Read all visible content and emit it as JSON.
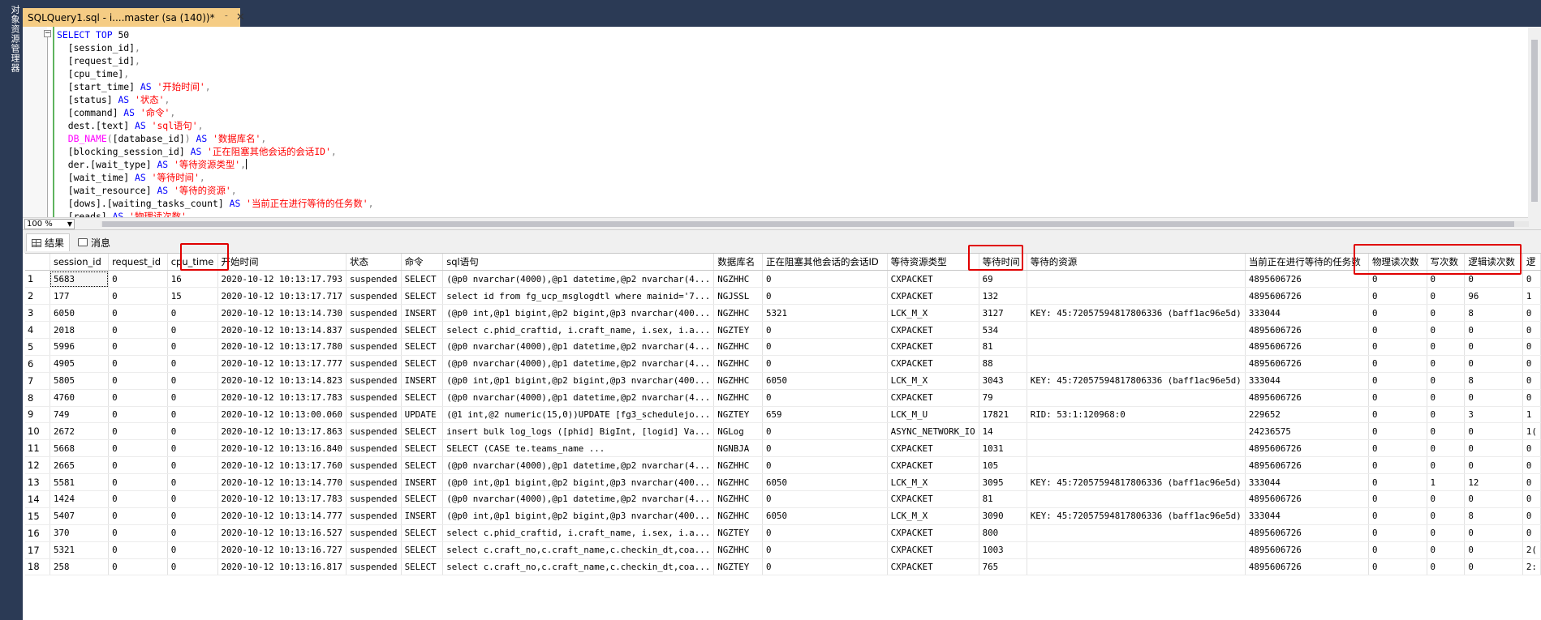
{
  "sidebar": {
    "label": "对象资源管理器"
  },
  "tab": {
    "title": "SQLQuery1.sql - i....master (sa (140))*",
    "pin_glyph": "ᐨ",
    "close_glyph": "✕"
  },
  "editor": {
    "lines": [
      [
        {
          "t": "SELECT TOP ",
          "c": "kw"
        },
        {
          "t": "50",
          "c": "id"
        }
      ],
      [
        {
          "t": "  [session_id]",
          "c": "id"
        },
        {
          "t": ",",
          "c": "op"
        }
      ],
      [
        {
          "t": "  [request_id]",
          "c": "id"
        },
        {
          "t": ",",
          "c": "op"
        }
      ],
      [
        {
          "t": "  [cpu_time]",
          "c": "id"
        },
        {
          "t": ",",
          "c": "op"
        }
      ],
      [
        {
          "t": "  [start_time] ",
          "c": "id"
        },
        {
          "t": "AS ",
          "c": "kw"
        },
        {
          "t": "'开始时间'",
          "c": "str"
        },
        {
          "t": ",",
          "c": "op"
        }
      ],
      [
        {
          "t": "  [status] ",
          "c": "id"
        },
        {
          "t": "AS ",
          "c": "kw"
        },
        {
          "t": "'状态'",
          "c": "str"
        },
        {
          "t": ",",
          "c": "op"
        }
      ],
      [
        {
          "t": "  [command] ",
          "c": "id"
        },
        {
          "t": "AS ",
          "c": "kw"
        },
        {
          "t": "'命令'",
          "c": "str"
        },
        {
          "t": ",",
          "c": "op"
        }
      ],
      [
        {
          "t": "  dest.[text] ",
          "c": "id"
        },
        {
          "t": "AS ",
          "c": "kw"
        },
        {
          "t": "'sql语句'",
          "c": "str"
        },
        {
          "t": ",",
          "c": "op"
        }
      ],
      [
        {
          "t": "  DB_NAME",
          "c": "fn"
        },
        {
          "t": "(",
          "c": "op"
        },
        {
          "t": "[database_id]",
          "c": "id"
        },
        {
          "t": ") ",
          "c": "op"
        },
        {
          "t": "AS ",
          "c": "kw"
        },
        {
          "t": "'数据库名'",
          "c": "str"
        },
        {
          "t": ",",
          "c": "op"
        }
      ],
      [
        {
          "t": "  [blocking_session_id] ",
          "c": "id"
        },
        {
          "t": "AS ",
          "c": "kw"
        },
        {
          "t": "'正在阻塞其他会话的会话ID'",
          "c": "str"
        },
        {
          "t": ",",
          "c": "op"
        }
      ],
      [
        {
          "t": "  der.[wait_type] ",
          "c": "id"
        },
        {
          "t": "AS ",
          "c": "kw"
        },
        {
          "t": "'等待资源类型'",
          "c": "str"
        },
        {
          "t": ",",
          "c": "op"
        },
        {
          "t": "CARET",
          "c": "caret"
        }
      ],
      [
        {
          "t": "  [wait_time] ",
          "c": "id"
        },
        {
          "t": "AS ",
          "c": "kw"
        },
        {
          "t": "'等待时间'",
          "c": "str"
        },
        {
          "t": ",",
          "c": "op"
        }
      ],
      [
        {
          "t": "  [wait_resource] ",
          "c": "id"
        },
        {
          "t": "AS ",
          "c": "kw"
        },
        {
          "t": "'等待的资源'",
          "c": "str"
        },
        {
          "t": ",",
          "c": "op"
        }
      ],
      [
        {
          "t": "  [dows].[waiting_tasks_count] ",
          "c": "id"
        },
        {
          "t": "AS ",
          "c": "kw"
        },
        {
          "t": "'当前正在进行等待的任务数'",
          "c": "str"
        },
        {
          "t": ",",
          "c": "op"
        }
      ],
      [
        {
          "t": "  [reads] ",
          "c": "id"
        },
        {
          "t": "AS ",
          "c": "kw"
        },
        {
          "t": "'物理读次数'",
          "c": "str"
        },
        {
          "t": ",",
          "c": "op"
        }
      ]
    ]
  },
  "zoom": {
    "value": "100 %"
  },
  "result_tabs": {
    "results": "结果",
    "messages": "消息"
  },
  "grid": {
    "columns": [
      "",
      "session_id",
      "request_id",
      "cpu_time",
      "开始时间",
      "状态",
      "命令",
      "sql语句",
      "数据库名",
      "正在阻塞其他会话的会话ID",
      "等待资源类型",
      "等待时间",
      "等待的资源",
      "当前正在进行等待的任务数",
      "物理读次数",
      "写次数",
      "逻辑读次数",
      "逻"
    ],
    "rows": [
      [
        "1",
        "5683",
        "0",
        "16",
        "2020-10-12 10:13:17.793",
        "suspended",
        "SELECT",
        "(@p0 nvarchar(4000),@p1 datetime,@p2 nvarchar(4...",
        "NGZHHC",
        "0",
        "CXPACKET",
        "69",
        "",
        "4895606726",
        "0",
        "0",
        "0",
        "0"
      ],
      [
        "2",
        "177",
        "0",
        "15",
        "2020-10-12 10:13:17.717",
        "suspended",
        "SELECT",
        "select id from fg_ucp_msglogdtl where mainid='7...",
        "NGJSSL",
        "0",
        "CXPACKET",
        "132",
        "",
        "4895606726",
        "0",
        "0",
        "96",
        "1"
      ],
      [
        "3",
        "6050",
        "0",
        "0",
        "2020-10-12 10:13:14.730",
        "suspended",
        "INSERT",
        "(@p0 int,@p1 bigint,@p2 bigint,@p3 nvarchar(400...",
        "NGZHHC",
        "5321",
        "LCK_M_X",
        "3127",
        "KEY: 45:72057594817806336 (baff1ac96e5d)",
        "333044",
        "0",
        "0",
        "8",
        "0"
      ],
      [
        "4",
        "2018",
        "0",
        "0",
        "2020-10-12 10:13:14.837",
        "suspended",
        "SELECT",
        "select c.phid_craftid, i.craft_name, i.sex, i.a...",
        "NGZTEY",
        "0",
        "CXPACKET",
        "534",
        "",
        "4895606726",
        "0",
        "0",
        "0",
        "0"
      ],
      [
        "5",
        "5996",
        "0",
        "0",
        "2020-10-12 10:13:17.780",
        "suspended",
        "SELECT",
        "(@p0 nvarchar(4000),@p1 datetime,@p2 nvarchar(4...",
        "NGZHHC",
        "0",
        "CXPACKET",
        "81",
        "",
        "4895606726",
        "0",
        "0",
        "0",
        "0"
      ],
      [
        "6",
        "4905",
        "0",
        "0",
        "2020-10-12 10:13:17.777",
        "suspended",
        "SELECT",
        "(@p0 nvarchar(4000),@p1 datetime,@p2 nvarchar(4...",
        "NGZHHC",
        "0",
        "CXPACKET",
        "88",
        "",
        "4895606726",
        "0",
        "0",
        "0",
        "0"
      ],
      [
        "7",
        "5805",
        "0",
        "0",
        "2020-10-12 10:13:14.823",
        "suspended",
        "INSERT",
        "(@p0 int,@p1 bigint,@p2 bigint,@p3 nvarchar(400...",
        "NGZHHC",
        "6050",
        "LCK_M_X",
        "3043",
        "KEY: 45:72057594817806336 (baff1ac96e5d)",
        "333044",
        "0",
        "0",
        "8",
        "0"
      ],
      [
        "8",
        "4760",
        "0",
        "0",
        "2020-10-12 10:13:17.783",
        "suspended",
        "SELECT",
        "(@p0 nvarchar(4000),@p1 datetime,@p2 nvarchar(4...",
        "NGZHHC",
        "0",
        "CXPACKET",
        "79",
        "",
        "4895606726",
        "0",
        "0",
        "0",
        "0"
      ],
      [
        "9",
        "749",
        "0",
        "0",
        "2020-10-12 10:13:00.060",
        "suspended",
        "UPDATE",
        "(@1 int,@2 numeric(15,0))UPDATE [fg3_schedulejo...",
        "NGZTEY",
        "659",
        "LCK_M_U",
        "17821",
        "RID: 53:1:120968:0",
        "229652",
        "0",
        "0",
        "3",
        "1"
      ],
      [
        "10",
        "2672",
        "0",
        "0",
        "2020-10-12 10:13:17.863",
        "suspended",
        "SELECT",
        "insert bulk log_logs ([phid] BigInt, [logid] Va...",
        "NGLog",
        "0",
        "ASYNC_NETWORK_IO",
        "14",
        "",
        "24236575",
        "0",
        "0",
        "0",
        "1("
      ],
      [
        "11",
        "5668",
        "0",
        "0",
        "2020-10-12 10:13:16.840",
        "suspended",
        "SELECT",
        "SELECT (CASE te.teams_name                   ...",
        "NGNBJA",
        "0",
        "CXPACKET",
        "1031",
        "",
        "4895606726",
        "0",
        "0",
        "0",
        "0"
      ],
      [
        "12",
        "2665",
        "0",
        "0",
        "2020-10-12 10:13:17.760",
        "suspended",
        "SELECT",
        "(@p0 nvarchar(4000),@p1 datetime,@p2 nvarchar(4...",
        "NGZHHC",
        "0",
        "CXPACKET",
        "105",
        "",
        "4895606726",
        "0",
        "0",
        "0",
        "0"
      ],
      [
        "13",
        "5581",
        "0",
        "0",
        "2020-10-12 10:13:14.770",
        "suspended",
        "INSERT",
        "(@p0 int,@p1 bigint,@p2 bigint,@p3 nvarchar(400...",
        "NGZHHC",
        "6050",
        "LCK_M_X",
        "3095",
        "KEY: 45:72057594817806336 (baff1ac96e5d)",
        "333044",
        "0",
        "1",
        "12",
        "0"
      ],
      [
        "14",
        "1424",
        "0",
        "0",
        "2020-10-12 10:13:17.783",
        "suspended",
        "SELECT",
        "(@p0 nvarchar(4000),@p1 datetime,@p2 nvarchar(4...",
        "NGZHHC",
        "0",
        "CXPACKET",
        "81",
        "",
        "4895606726",
        "0",
        "0",
        "0",
        "0"
      ],
      [
        "15",
        "5407",
        "0",
        "0",
        "2020-10-12 10:13:14.777",
        "suspended",
        "INSERT",
        "(@p0 int,@p1 bigint,@p2 bigint,@p3 nvarchar(400...",
        "NGZHHC",
        "6050",
        "LCK_M_X",
        "3090",
        "KEY: 45:72057594817806336 (baff1ac96e5d)",
        "333044",
        "0",
        "0",
        "8",
        "0"
      ],
      [
        "16",
        "370",
        "0",
        "0",
        "2020-10-12 10:13:16.527",
        "suspended",
        "SELECT",
        "select c.phid_craftid, i.craft_name, i.sex, i.a...",
        "NGZTEY",
        "0",
        "CXPACKET",
        "800",
        "",
        "4895606726",
        "0",
        "0",
        "0",
        "0"
      ],
      [
        "17",
        "5321",
        "0",
        "0",
        "2020-10-12 10:13:16.727",
        "suspended",
        "SELECT",
        "select c.craft_no,c.craft_name,c.checkin_dt,coa...",
        "NGZHHC",
        "0",
        "CXPACKET",
        "1003",
        "",
        "4895606726",
        "0",
        "0",
        "0",
        "2("
      ],
      [
        "18",
        "258",
        "0",
        "0",
        "2020-10-12 10:13:16.817",
        "suspended",
        "SELECT",
        "select c.craft_no,c.craft_name,c.checkin_dt,coa...",
        "NGZTEY",
        "0",
        "CXPACKET",
        "765",
        "",
        "4895606726",
        "0",
        "0",
        "0",
        "2:"
      ]
    ]
  },
  "highlight_color": "#e00000"
}
